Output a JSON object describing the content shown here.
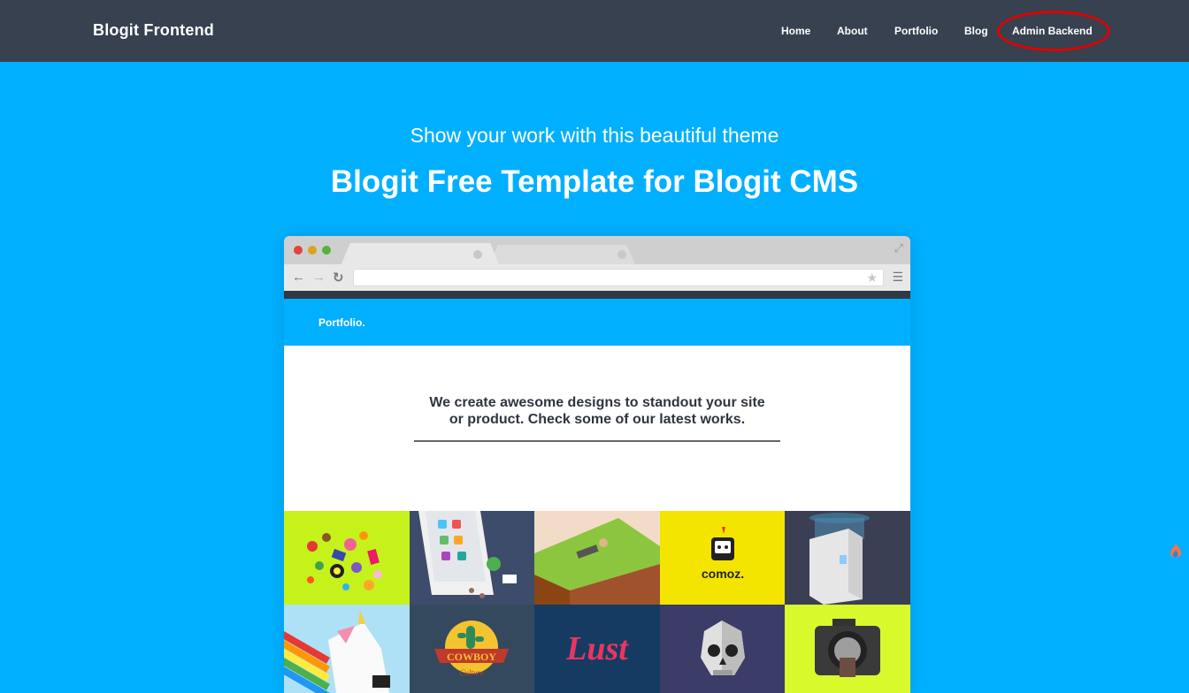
{
  "navbar": {
    "brand": "Blogit Frontend",
    "links": [
      {
        "label": "Home"
      },
      {
        "label": "About"
      },
      {
        "label": "Portfolio"
      },
      {
        "label": "Blog"
      },
      {
        "label": "Admin Backend"
      }
    ]
  },
  "hero": {
    "subtitle": "Show your work with this beautiful theme",
    "title": "Blogit Free Template for Blogit CMS"
  },
  "mockup": {
    "brand": "Portfolio.",
    "headline_line1": "We create awesome designs to standout your site",
    "headline_line2": "or product. Check some of our latest works.",
    "tiles": [
      {
        "icon": "sweets-icon",
        "color": "#c6f21c"
      },
      {
        "icon": "phone-icon",
        "color": "#3d4c6a"
      },
      {
        "icon": "hill-icon",
        "color": "#f3dcc7"
      },
      {
        "icon": "comoz-logo",
        "color": "#f4e500",
        "text": "comoz."
      },
      {
        "icon": "water-cooler-icon",
        "color": "#3a3f54"
      },
      {
        "icon": "unicorn-icon",
        "color": "#aee1f5"
      },
      {
        "icon": "cowboy-badge-icon",
        "color": "#34495e",
        "text": "COWBOY",
        "subtext": "Culture"
      },
      {
        "icon": "lust-logo",
        "color": "#163b63",
        "text": "Lust"
      },
      {
        "icon": "skull-icon",
        "color": "#3b3c68"
      },
      {
        "icon": "camera-icon",
        "color": "#d8fa2c"
      }
    ]
  },
  "colors": {
    "navbar_bg": "#37414f",
    "page_bg": "#00b0ff",
    "highlight_ring": "#e00000"
  }
}
